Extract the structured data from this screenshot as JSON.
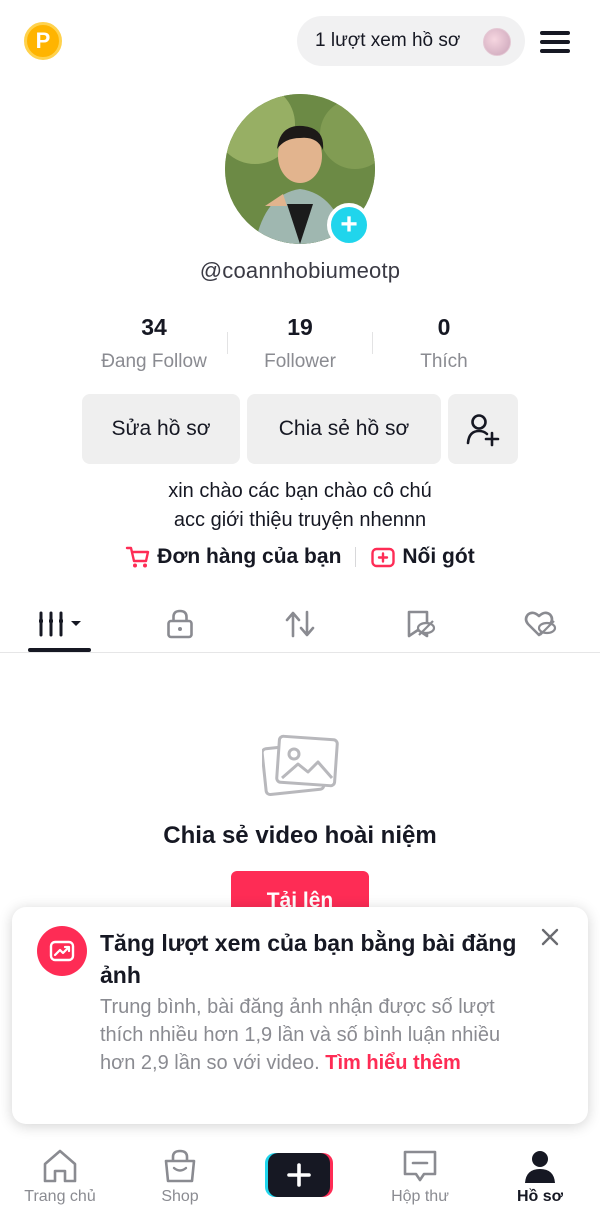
{
  "header": {
    "coin_label": "P",
    "profile_views": "1 lượt xem hồ sơ"
  },
  "profile": {
    "username": "@coannhobiumeotp",
    "stats": [
      {
        "value": "34",
        "label": "Đang Follow"
      },
      {
        "value": "19",
        "label": "Follower"
      },
      {
        "value": "0",
        "label": "Thích"
      }
    ],
    "buttons": {
      "edit": "Sửa hồ sơ",
      "share": "Chia sẻ hồ sơ"
    },
    "bio": [
      "xin chào các bạn chào cô chú",
      "acc giới thiệu truyện nhennn"
    ],
    "links": {
      "orders": "Đơn hàng của bạn",
      "follow_shop": "Nối gót"
    }
  },
  "tabs": [
    "videos",
    "private",
    "reposts",
    "favorites",
    "liked"
  ],
  "empty_state": {
    "title": "Chia sẻ video hoài niệm",
    "upload_label": "Tải lên"
  },
  "toast": {
    "title": "Tăng lượt xem của bạn bằng bài đăng ảnh",
    "body": "Trung bình, bài đăng ảnh nhận được số lượt thích nhiều hơn 1,9 lần và số bình luận nhiều hơn 2,9 lần so với video.",
    "link": "Tìm hiểu thêm"
  },
  "bottom_nav": {
    "home": "Trang chủ",
    "shop": "Shop",
    "inbox": "Hộp thư",
    "profile": "Hồ sơ"
  },
  "colors": {
    "accent": "#fe2c55",
    "cyan": "#20d5ec",
    "text": "#161823",
    "muted": "#8a8b91"
  }
}
